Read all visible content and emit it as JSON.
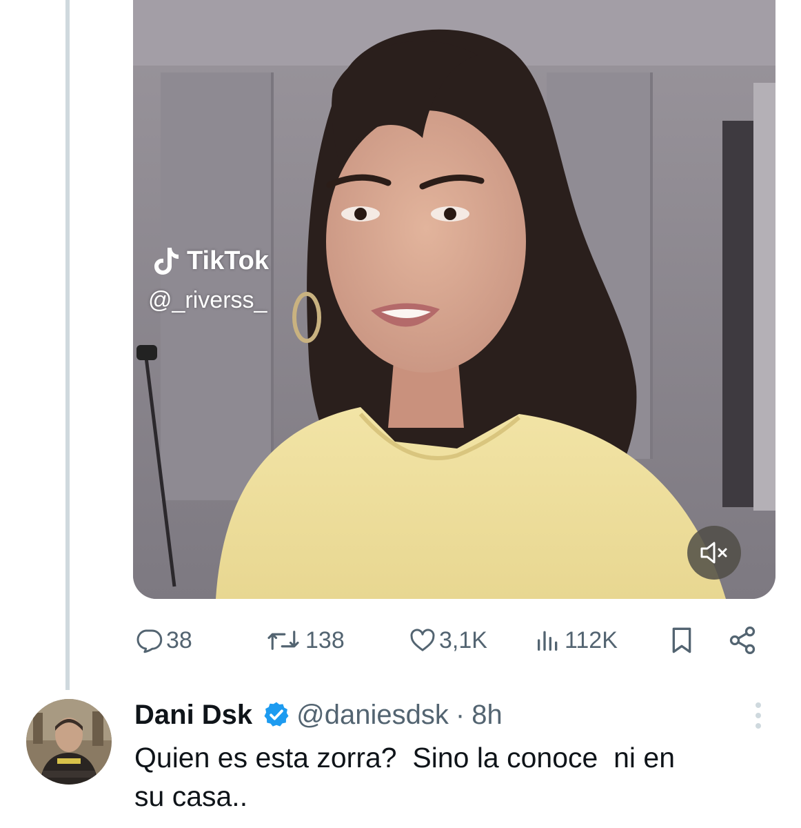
{
  "video": {
    "watermark_brand": "TikTok",
    "watermark_handle": "@_riverss_"
  },
  "actions": {
    "replies": "38",
    "reposts": "138",
    "likes": "3,1K",
    "views": "112K"
  },
  "reply": {
    "name": "Dani Dsk",
    "handle": "@daniesdsk",
    "separator": "·",
    "time": "8h",
    "text": "Quien es esta zorra?  Sino la conoce  ni en\nsu casa.."
  },
  "icons": {
    "reply": "speech-bubble-icon",
    "repost": "repost-arrows-icon",
    "like": "heart-icon",
    "views": "bar-chart-icon",
    "bookmark": "bookmark-icon",
    "share": "share-icon",
    "mute": "speaker-muted-icon",
    "verified": "verified-badge-icon",
    "more": "more-vertical-icon"
  },
  "colors": {
    "thread_line": "#cfd9de",
    "secondary_text": "#536471",
    "verified_blue": "#1d9bf0",
    "primary_text": "#0f1419"
  }
}
